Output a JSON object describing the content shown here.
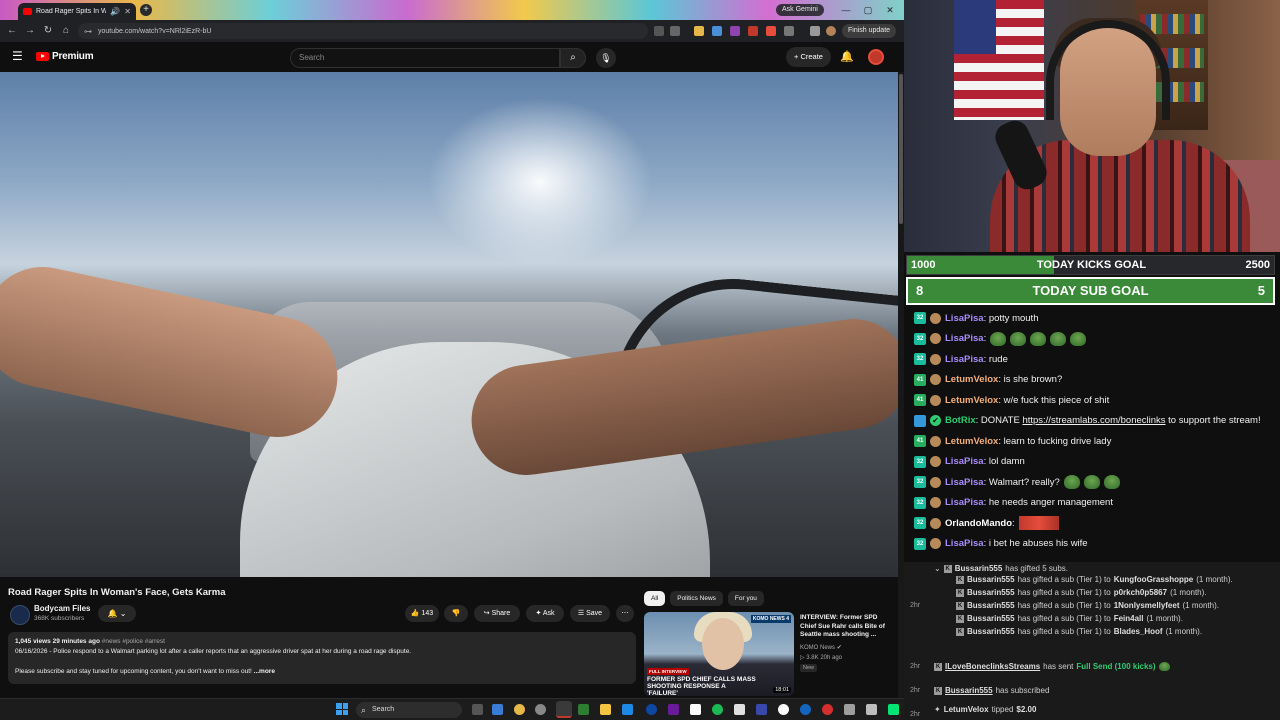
{
  "browser": {
    "tab_title": "Road Rager Spits In Woma",
    "url": "youtube.com/watch?v=NRl2iEzR-bU",
    "ask_gemini": "Ask Gemini",
    "finish_update": "Finish update"
  },
  "youtube": {
    "logo_text": "Premium",
    "search_placeholder": "Search",
    "create_label": "+ Create"
  },
  "video": {
    "title": "Road Rager Spits In Woman's Face, Gets Karma",
    "channel": "Bodycam Files",
    "subscribers": "368K subscribers",
    "likes": "143",
    "share_label": "Share",
    "ask_label": "Ask",
    "save_label": "Save",
    "description": {
      "views": "1,045 views",
      "age": "29 minutes ago",
      "tags": "#news #police #arrest",
      "line1": "06/16/2026 - Police respond to a Walmart parking lot after a caller reports that an aggressive driver spat at her during a road rage dispute.",
      "line2": "Please subscribe and stay tuned for upcoming content, you don't want to miss out!",
      "more": "...more"
    }
  },
  "recommendations": {
    "chips": [
      "All",
      "Politics News",
      "For you"
    ],
    "item": {
      "title": "INTERVIEW: Former SPD Chief Sue Rahr calls Bite of Seattle mass shooting ...",
      "channel": "KOMO News",
      "views": "3.8K",
      "age": "20h ago",
      "badge": "New",
      "duration": "18:01",
      "thumb_tag": "FULL INTERVIEW",
      "thumb_headline": "FORMER SPD CHIEF CALLS MASS SHOOTING RESPONSE A 'FAILURE'",
      "thumb_logo": "KOMO NEWS 4"
    }
  },
  "goals": {
    "kicks": {
      "left": "1000",
      "title": "TODAY KICKS GOAL",
      "right": "2500",
      "progress": 0.4
    },
    "subs": {
      "left": "8",
      "title": "TODAY SUB GOAL",
      "right": "5"
    }
  },
  "chat": [
    {
      "badge": "32",
      "badge_color": "#1abc9c",
      "user": "LisaPisa",
      "color": "#a78bfa",
      "text": ": potty mouth",
      "emotes": 0
    },
    {
      "badge": "32",
      "badge_color": "#1abc9c",
      "user": "LisaPisa",
      "color": "#a78bfa",
      "text": ":",
      "emotes": 5
    },
    {
      "badge": "32",
      "badge_color": "#1abc9c",
      "user": "LisaPisa",
      "color": "#a78bfa",
      "text": ": rude",
      "emotes": 0
    },
    {
      "badge": "41",
      "badge_color": "#27ae60",
      "user": "LetumVelox",
      "color": "#f4b07a",
      "text": ": is she brown?",
      "emotes": 0
    },
    {
      "badge": "41",
      "badge_color": "#27ae60",
      "user": "LetumVelox",
      "color": "#f4b07a",
      "text": ": w/e fuck this piece of shit",
      "emotes": 0
    },
    {
      "badge": "",
      "badge_color": "#3498db",
      "user": "BotRix",
      "color": "#2ecc71",
      "text": ": DONATE ",
      "link": "https://streamlabs.com/boneclinks",
      "after": " to support the stream!",
      "emotes": 0
    },
    {
      "badge": "41",
      "badge_color": "#27ae60",
      "user": "LetumVelox",
      "color": "#f4b07a",
      "text": ": learn to fucking drive lady",
      "emotes": 0
    },
    {
      "badge": "32",
      "badge_color": "#1abc9c",
      "user": "LisaPisa",
      "color": "#a78bfa",
      "text": ": lol damn",
      "emotes": 0
    },
    {
      "badge": "32",
      "badge_color": "#1abc9c",
      "user": "LisaPisa",
      "color": "#a78bfa",
      "text": ": Walmart? really?",
      "emotes": 3
    },
    {
      "badge": "32",
      "badge_color": "#1abc9c",
      "user": "LisaPisa",
      "color": "#a78bfa",
      "text": ": he needs anger management",
      "emotes": 0
    },
    {
      "badge": "32",
      "badge_color": "#1abc9c",
      "user": "OrlandoMando",
      "color": "#ffffff",
      "text": ":",
      "emotes": 0,
      "red_emote": true
    },
    {
      "badge": "32",
      "badge_color": "#1abc9c",
      "user": "LisaPisa",
      "color": "#a78bfa",
      "text": ": i bet he abuses his wife",
      "emotes": 0
    }
  ],
  "events": {
    "gift_header": {
      "user": "Bussarin555",
      "text": "has gifted 5 subs."
    },
    "gift_lines": [
      {
        "user": "Bussarin555",
        "text": "has gifted a sub (Tier 1) to",
        "to": "KungfooGrasshoppe",
        "dur": "(1 month)."
      },
      {
        "user": "Bussarin555",
        "text": "has gifted a sub (Tier 1) to",
        "to": "p0rkch0p5867",
        "dur": "(1 month)."
      },
      {
        "user": "Bussarin555",
        "text": "has gifted a sub (Tier 1) to",
        "to": "1Nonlysmellyfeet",
        "dur": "(1 month)."
      },
      {
        "user": "Bussarin555",
        "text": "has gifted a sub (Tier 1) to",
        "to": "Fein4all",
        "dur": "(1 month)."
      },
      {
        "user": "Bussarin555",
        "text": "has gifted a sub (Tier 1) to",
        "to": "Blades_Hoof",
        "dur": "(1 month)."
      }
    ],
    "gift_time": "2hr",
    "kicks": {
      "time": "2hr",
      "user": "ILoveBoneclinksStreams",
      "text": "has sent",
      "item": "Full Send (100 kicks)"
    },
    "subscribed": {
      "time": "2hr",
      "user": "Bussarin555",
      "text": "has subscribed"
    },
    "tip": {
      "time": "2hr",
      "user": "LetumVelox",
      "text": "tipped",
      "amount": "$2.00"
    }
  },
  "taskbar": {
    "search": "Search"
  }
}
